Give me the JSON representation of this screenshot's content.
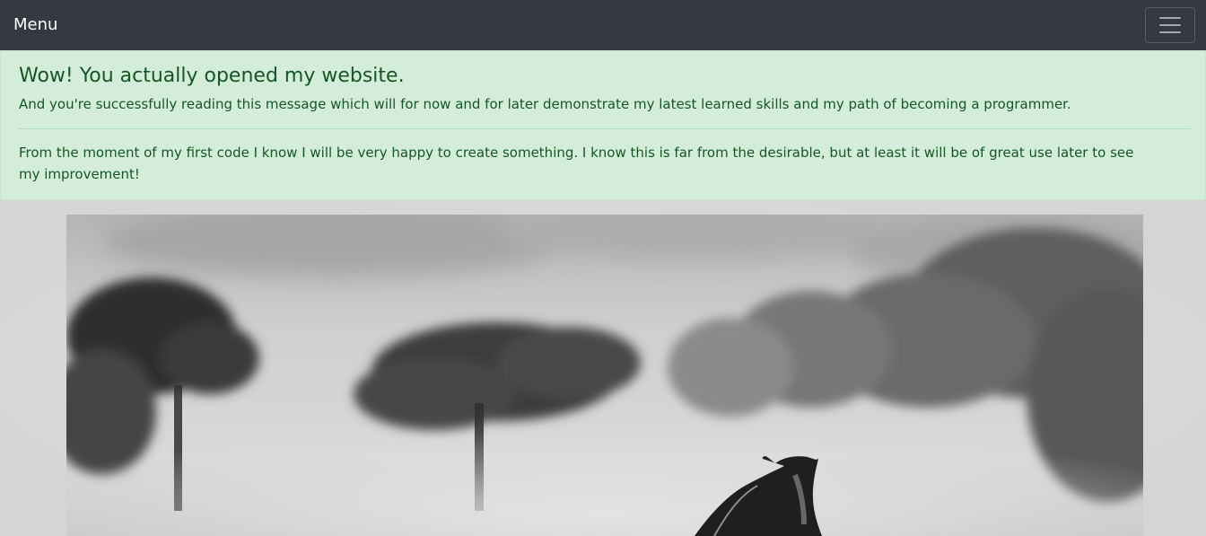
{
  "navbar": {
    "brand": "Menu",
    "toggler_icon": "hamburger-icon",
    "background": "#343a40"
  },
  "alert": {
    "heading": "Wow! You actually opened my website.",
    "lead": "And you're successfully reading this message which will for now and for later demonstrate my latest learned skills and my path of becoming a programmer.",
    "body": "From the moment of my first code I know I will be very happy to create something. I know this is far from the desirable, but at least it will be of great use later to see my improvement!",
    "background": "#d4edda",
    "text_color": "#155724"
  },
  "hero": {
    "subject": "black-and-white photo of a horse running through misty trees"
  }
}
